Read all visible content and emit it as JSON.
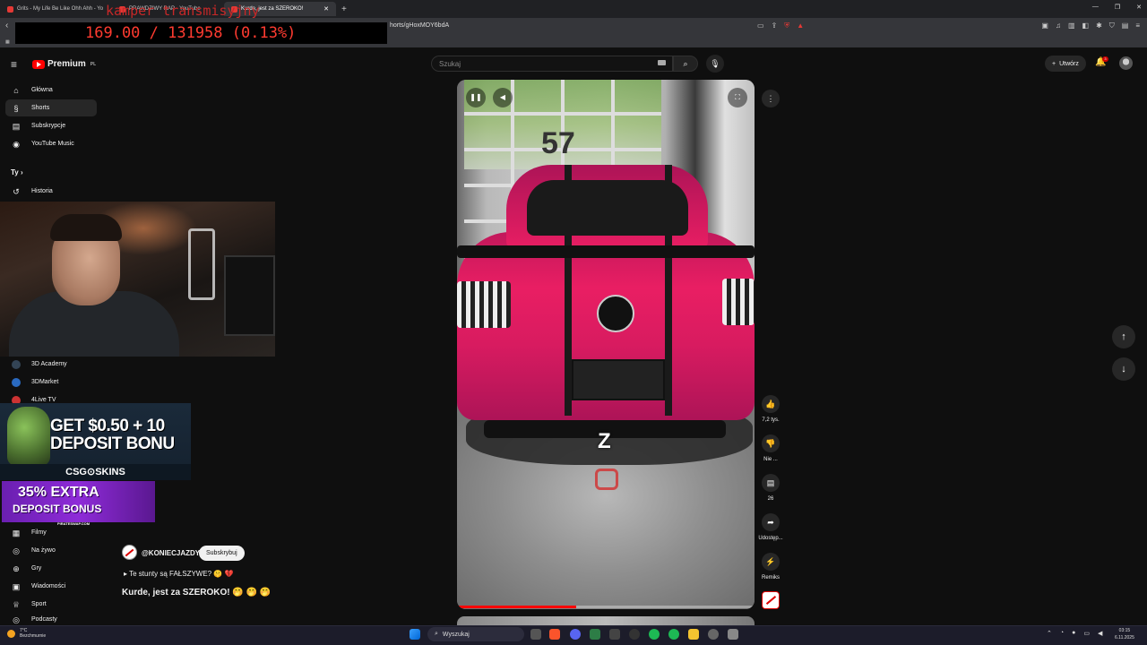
{
  "browser": {
    "tabs": [
      {
        "title": "Grits - My Life Be Like Ohh Ahh - Yo",
        "active": false
      },
      {
        "title": "PRAWDZIWY RAP - YouTube",
        "active": false
      },
      {
        "title": "Kurde, jest za SZEROKO!",
        "active": true
      }
    ],
    "new_tab": "+",
    "url": "horts/gHoxMOY6bdA"
  },
  "stream_overlay": {
    "title": "kamper transmisyjny",
    "counter": "169.00 / 131958 (0.13%)"
  },
  "youtube": {
    "logo_text": "Premium",
    "logo_region": "PL",
    "search_placeholder": "Szukaj",
    "create_label": "Utwórz",
    "notification_count": "3"
  },
  "sidebar": {
    "items": [
      {
        "label": "Główna",
        "icon": "home-icon",
        "glyph": "⌂"
      },
      {
        "label": "Shorts",
        "icon": "shorts-icon",
        "glyph": "§"
      },
      {
        "label": "Subskrypcje",
        "icon": "subscriptions-icon",
        "glyph": "▤"
      },
      {
        "label": "YouTube Music",
        "icon": "music-icon",
        "glyph": "◉"
      }
    ],
    "you_header": "Ty",
    "history": "Historia",
    "subs": [
      {
        "label": "3D Academy"
      },
      {
        "label": "3DMarket"
      },
      {
        "label": "4Live TV"
      }
    ],
    "explore": [
      {
        "label": "Filmy",
        "glyph": "▦"
      },
      {
        "label": "Na żywo",
        "glyph": "((•))"
      },
      {
        "label": "Gry",
        "glyph": "⊕"
      },
      {
        "label": "Wiadomości",
        "glyph": "▣"
      },
      {
        "label": "Sport",
        "glyph": "♕"
      },
      {
        "label": "Podcasty",
        "glyph": "◎"
      }
    ]
  },
  "ads": {
    "ad1_text_line1": "GET $0.50 + 10",
    "ad1_text_line2": "DEPOSIT BONU",
    "ad1_logo": "CSG⊙SKINS",
    "ad2_line1": "35% EXTRA",
    "ad2_line2": "DEPOSIT BONUS",
    "ad2_small": "PIRATESWAP.COM"
  },
  "short": {
    "channel": "@KONIECJAZDY",
    "subscribe_label": "Subskrybuj",
    "playlist": "Te stunty są FAŁSZYWE? 🤫 💔",
    "title": "Kurde, jest za SZEROKO! 🤭 🤭 🤭",
    "video_number": "57",
    "subtitle": "Z",
    "progress": 0.4,
    "actions": {
      "likes": "7,2 tys.",
      "dislike": "Nie ...",
      "comments": "26",
      "share": "Udostęp...",
      "remix": "Remiks"
    }
  },
  "taskbar": {
    "weather_temp": "7°C",
    "weather_desc": "Bezchmurnie",
    "search_label": "Wyszukaj",
    "time": "03:15",
    "date": "6.11.2025"
  },
  "colors": {
    "accent_red": "#ff0000",
    "background": "#0f0f0f",
    "counter_red": "#ff3b30"
  }
}
